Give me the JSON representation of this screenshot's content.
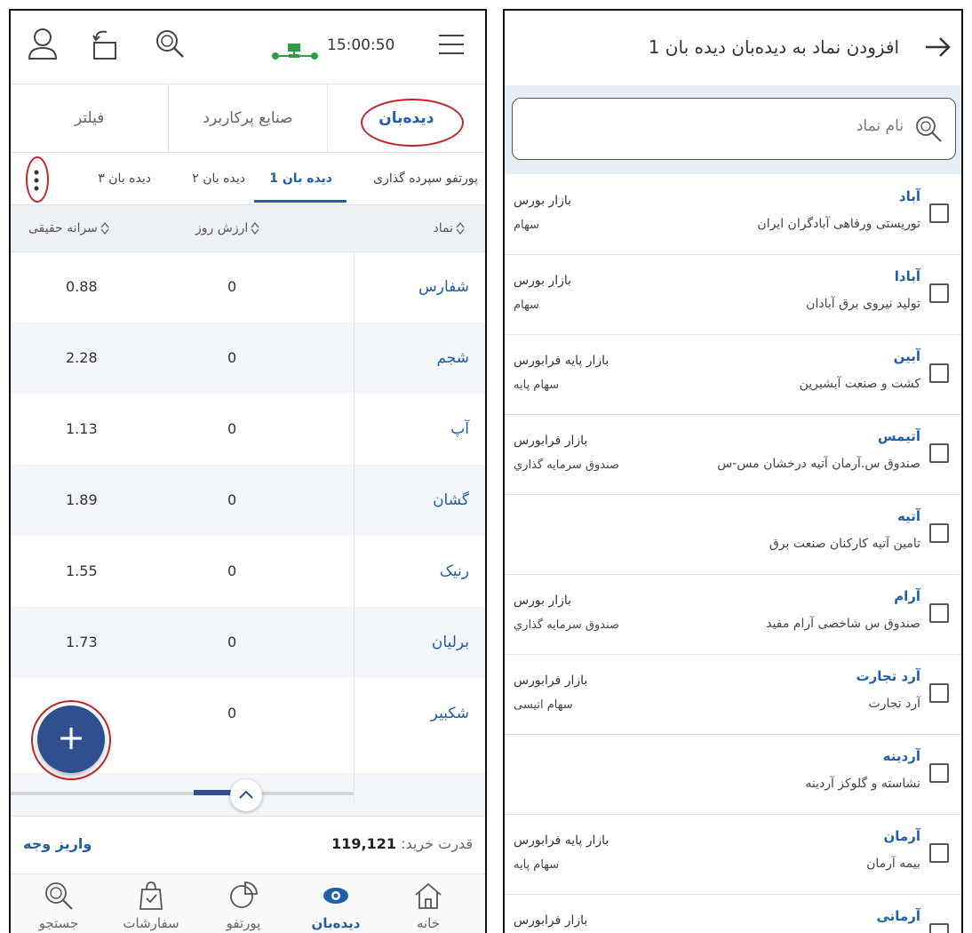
{
  "left": {
    "time": "15:00:50",
    "tabs": [
      "دیده‌بان",
      "صنایع پرکاربرد",
      "فیلتر"
    ],
    "sub_tabs": [
      "پورتفو سپرده گذاری",
      "دیده بان 1",
      "دیده بان ۲",
      "دیده بان ۳"
    ],
    "columns": {
      "symbol": "نماد",
      "value": "ارزش روز",
      "ratio": "سرانه حقیقی"
    },
    "rows": [
      {
        "symbol": "شفارس",
        "value": "0",
        "ratio": "0.88"
      },
      {
        "symbol": "شجم",
        "value": "0",
        "ratio": "2.28"
      },
      {
        "symbol": "آپ",
        "value": "0",
        "ratio": "1.13"
      },
      {
        "symbol": "گشان",
        "value": "0",
        "ratio": "1.89"
      },
      {
        "symbol": "رنیک",
        "value": "0",
        "ratio": "1.55"
      },
      {
        "symbol": "برلیان",
        "value": "0",
        "ratio": "1.73"
      },
      {
        "symbol": "شکبیر",
        "value": "0",
        "ratio": ""
      }
    ],
    "buying_power_label": "قدرت خرید:",
    "buying_power_value": "119,121",
    "deposit_label": "واریز وجه",
    "fab_label": "+",
    "nav": [
      "خانه",
      "دیده‌بان",
      "پورتفو",
      "سفارشات",
      "جستجو"
    ],
    "accent": "#1f5ea8",
    "highlight": "#c0262c"
  },
  "right": {
    "title": "افزودن نماد به دیده‌بان دیده بان 1",
    "search_placeholder": "نام نماد",
    "items": [
      {
        "symbol": "آباد",
        "name": "توریستی ورفاهی آبادگران ایران",
        "market": "بازار بورس",
        "type": "سهام"
      },
      {
        "symbol": "آبادا",
        "name": "تولید نیروی برق آبادان",
        "market": "بازار بورس",
        "type": "سهام"
      },
      {
        "symbol": "آبین",
        "name": "کشت و صنعت آبشیرین",
        "market": "بازار پایه فرابورس",
        "type": "سهام پایه"
      },
      {
        "symbol": "آتیمس",
        "name": "صندوق س.آرمان آتیه درخشان مس-س",
        "market": "بازار فرابورس",
        "type": "صندوق سرمایه گذاري"
      },
      {
        "symbol": "آتیه",
        "name": "تامین آتیه کارکنان صنعت برق",
        "market": "",
        "type": ""
      },
      {
        "symbol": "آرام",
        "name": "صندوق س شاخصی آرام مفید",
        "market": "بازار بورس",
        "type": "صندوق سرمایه گذاري"
      },
      {
        "symbol": "آرد تجارت",
        "name": "آرد تجارت",
        "market": "بازار فرابورس",
        "type": "سهام اتیسی"
      },
      {
        "symbol": "آردینه",
        "name": "نشاسته و گلوکز آردینه",
        "market": "",
        "type": ""
      },
      {
        "symbol": "آرمان",
        "name": "بیمه آرمان",
        "market": "بازار پایه فرابورس",
        "type": "سهام پایه"
      },
      {
        "symbol": "آرمانی",
        "name": "",
        "market": "بازار فرابورس",
        "type": ""
      }
    ]
  }
}
